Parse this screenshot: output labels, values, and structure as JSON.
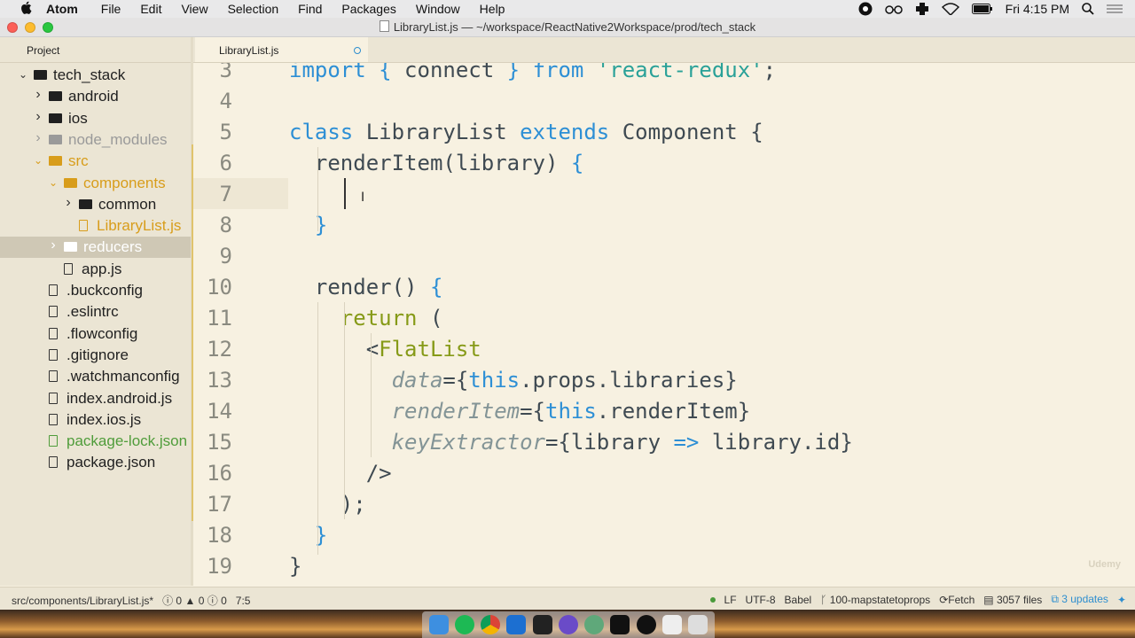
{
  "menubar": {
    "app": "Atom",
    "items": [
      "File",
      "Edit",
      "View",
      "Selection",
      "Find",
      "Packages",
      "Window",
      "Help"
    ],
    "clock": "Fri 4:15 PM"
  },
  "window": {
    "title": "LibraryList.js — ~/workspace/ReactNative2Workspace/prod/tech_stack"
  },
  "tabs": {
    "project_label": "Project",
    "editor_tab_label": "LibraryList.js"
  },
  "tree": [
    {
      "label": "tech_stack",
      "kind": "folder",
      "indent": 0,
      "chevron": "v",
      "color": "default"
    },
    {
      "label": "android",
      "kind": "folder",
      "indent": 1,
      "chevron": ">",
      "color": "default"
    },
    {
      "label": "ios",
      "kind": "folder",
      "indent": 1,
      "chevron": ">",
      "color": "default"
    },
    {
      "label": "node_modules",
      "kind": "folder",
      "indent": 1,
      "chevron": ">",
      "color": "dim"
    },
    {
      "label": "src",
      "kind": "folder",
      "indent": 1,
      "chevron": "v",
      "color": "orange"
    },
    {
      "label": "components",
      "kind": "folder",
      "indent": 2,
      "chevron": "v",
      "color": "orange"
    },
    {
      "label": "common",
      "kind": "folder",
      "indent": 3,
      "chevron": ">",
      "color": "default"
    },
    {
      "label": "LibraryList.js",
      "kind": "file",
      "indent": 3,
      "chevron": "",
      "color": "orange"
    },
    {
      "label": "reducers",
      "kind": "folder",
      "indent": 2,
      "chevron": ">",
      "color": "selected"
    },
    {
      "label": "app.js",
      "kind": "file",
      "indent": 2,
      "chevron": "",
      "color": "default"
    },
    {
      "label": ".buckconfig",
      "kind": "file",
      "indent": 1,
      "chevron": "",
      "color": "default"
    },
    {
      "label": ".eslintrc",
      "kind": "file",
      "indent": 1,
      "chevron": "",
      "color": "default"
    },
    {
      "label": ".flowconfig",
      "kind": "file",
      "indent": 1,
      "chevron": "",
      "color": "default"
    },
    {
      "label": ".gitignore",
      "kind": "file",
      "indent": 1,
      "chevron": "",
      "color": "default"
    },
    {
      "label": ".watchmanconfig",
      "kind": "file",
      "indent": 1,
      "chevron": "",
      "color": "default"
    },
    {
      "label": "index.android.js",
      "kind": "file",
      "indent": 1,
      "chevron": "",
      "color": "default"
    },
    {
      "label": "index.ios.js",
      "kind": "file",
      "indent": 1,
      "chevron": "",
      "color": "default"
    },
    {
      "label": "package-lock.json",
      "kind": "file",
      "indent": 1,
      "chevron": "",
      "color": "green"
    },
    {
      "label": "package.json",
      "kind": "file",
      "indent": 1,
      "chevron": "",
      "color": "default"
    }
  ],
  "editor": {
    "line_numbers": [
      "3",
      "4",
      "5",
      "6",
      "7",
      "8",
      "9",
      "10",
      "11",
      "12",
      "13",
      "14",
      "15",
      "16",
      "17",
      "18",
      "19"
    ],
    "lines": [
      [
        [
          "k",
          "import"
        ],
        [
          "c",
          " "
        ],
        [
          "k",
          "{"
        ],
        [
          "c",
          " connect "
        ],
        [
          "k",
          "}"
        ],
        [
          "c",
          " "
        ],
        [
          "k",
          "from"
        ],
        [
          "c",
          " "
        ],
        [
          "st",
          "'react-redux'"
        ],
        [
          "c",
          ";"
        ]
      ],
      [],
      [
        [
          "k",
          "class"
        ],
        [
          "c",
          " LibraryList "
        ],
        [
          "k",
          "extends"
        ],
        [
          "c",
          " Component "
        ],
        [
          "c",
          "{"
        ]
      ],
      [
        [
          "c",
          "  renderItem(library) "
        ],
        [
          "k",
          "{"
        ]
      ],
      [],
      [
        [
          "c",
          "  "
        ],
        [
          "k",
          "}"
        ]
      ],
      [],
      [
        [
          "c",
          "  render() "
        ],
        [
          "k",
          "{"
        ]
      ],
      [
        [
          "c",
          "    "
        ],
        [
          "t",
          "return"
        ],
        [
          "c",
          " ("
        ]
      ],
      [
        [
          "c",
          "      "
        ],
        [
          "c",
          "<"
        ],
        [
          "t",
          "FlatList"
        ]
      ],
      [
        [
          "c",
          "        "
        ],
        [
          "a",
          "data"
        ],
        [
          "c",
          "={"
        ],
        [
          "k",
          "this"
        ],
        [
          "c",
          ".props.libraries}"
        ]
      ],
      [
        [
          "c",
          "        "
        ],
        [
          "a",
          "renderItem"
        ],
        [
          "c",
          "={"
        ],
        [
          "k",
          "this"
        ],
        [
          "c",
          ".renderItem}"
        ]
      ],
      [
        [
          "c",
          "        "
        ],
        [
          "a",
          "keyExtractor"
        ],
        [
          "c",
          "={library "
        ],
        [
          "k",
          "=>"
        ],
        [
          "c",
          " library.id}"
        ]
      ],
      [
        [
          "c",
          "      />"
        ]
      ],
      [
        [
          "c",
          "    );"
        ]
      ],
      [
        [
          "c",
          "  "
        ],
        [
          "k",
          "}"
        ]
      ],
      [
        [
          "c",
          "}"
        ]
      ]
    ]
  },
  "status": {
    "file_path": "src/components/LibraryList.js*",
    "errors": "0",
    "warnings": "0",
    "infos": "0",
    "cursor_pos": "7:5",
    "line_ending": "LF",
    "encoding": "UTF-8",
    "grammar": "Babel",
    "branch": "100-mapstatetoprops",
    "fetch": "Fetch",
    "files": "3057 files",
    "updates": "3 updates"
  },
  "watermark": "Udemy",
  "colors": {
    "editor_bg": "#f7f1e1",
    "sidebar_bg": "#ebe5d4",
    "keyword": "#2d8fd5",
    "tag": "#869a17",
    "git_modified": "#d89d1b",
    "git_new": "#4f9c3a"
  }
}
